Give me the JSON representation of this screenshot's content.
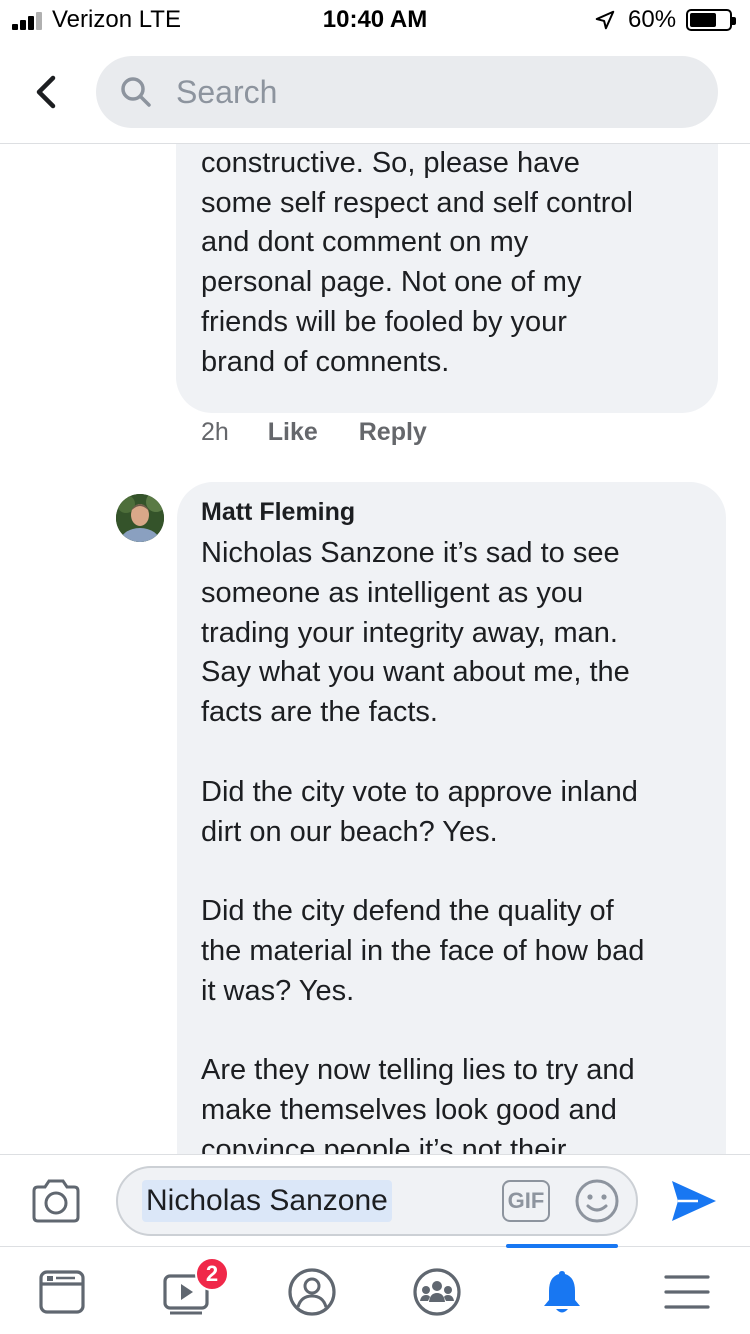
{
  "status_bar": {
    "carrier": "Verizon  LTE",
    "time": "10:40 AM",
    "battery": "60%",
    "battery_level": 0.6
  },
  "header": {
    "back_icon": "chevron-left-icon",
    "search_placeholder": "Search"
  },
  "comments": [
    {
      "author": "",
      "text": "own agenda and it is not\nconstructive. So, please have\nsome self respect and self control\nand dont comment on my\npersonal page. Not one of my\nfriends will be fooled by your\nbrand of comnents.",
      "time": "2h",
      "like_label": "Like",
      "reply_label": "Reply"
    },
    {
      "author": "Matt Fleming",
      "text": "Nicholas Sanzone it’s sad to see\nsomeone as intelligent as you\ntrading your integrity away, man.\nSay what you want about me, the\nfacts are the facts.\n\nDid the city vote to approve inland\ndirt on our beach? Yes.\n\nDid the city defend the quality of\nthe material in the face of how bad\nit was? Yes.\n\nAre they now telling lies to try and\nmake themselves look good and\nconvince people it’s not their"
    }
  ],
  "composer": {
    "mention": "Nicholas Sanzone",
    "gif_label": "GIF",
    "camera_icon": "camera-icon",
    "emoji_icon": "emoji-icon",
    "send_icon": "send-icon",
    "send_color": "#1877f2"
  },
  "tabbar": {
    "tabs": [
      "news-feed-icon",
      "watch-icon",
      "profile-icon",
      "groups-icon",
      "notifications-icon",
      "menu-icon"
    ],
    "active_tab": "notifications-icon",
    "watch_badge": "2",
    "accent": "#1877f2"
  }
}
